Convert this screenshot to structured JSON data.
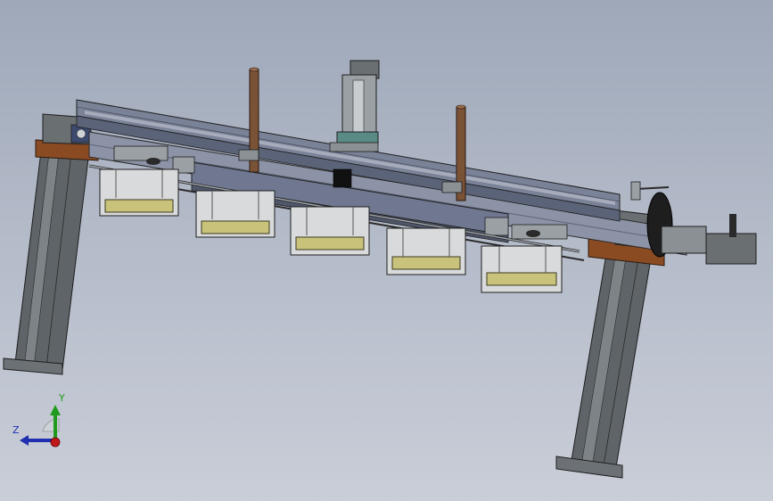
{
  "viewport": {
    "background_top": "#9ea8b9",
    "background_bottom": "#c9ced8"
  },
  "model": {
    "description_visible": false,
    "colors": {
      "frame_steel": "#5c6266",
      "frame_steel_light": "#8a9094",
      "beam_blue_grey": "#6f7890",
      "copper_base": "#8a4a22",
      "rod_brown": "#7a5236",
      "gripper_pad_yellow": "#c8c27a",
      "gripper_frame_white": "#e8e8e8",
      "cylinder_grey": "#9aa0a4",
      "motor_body": "#6a6f72"
    },
    "gripper_count": 5
  },
  "triad": {
    "x_label": "",
    "y_label": "Y",
    "z_label": "Z",
    "y_color": "#1f9a1f",
    "z_color": "#1f2fb0",
    "x_color": "#c01818"
  }
}
